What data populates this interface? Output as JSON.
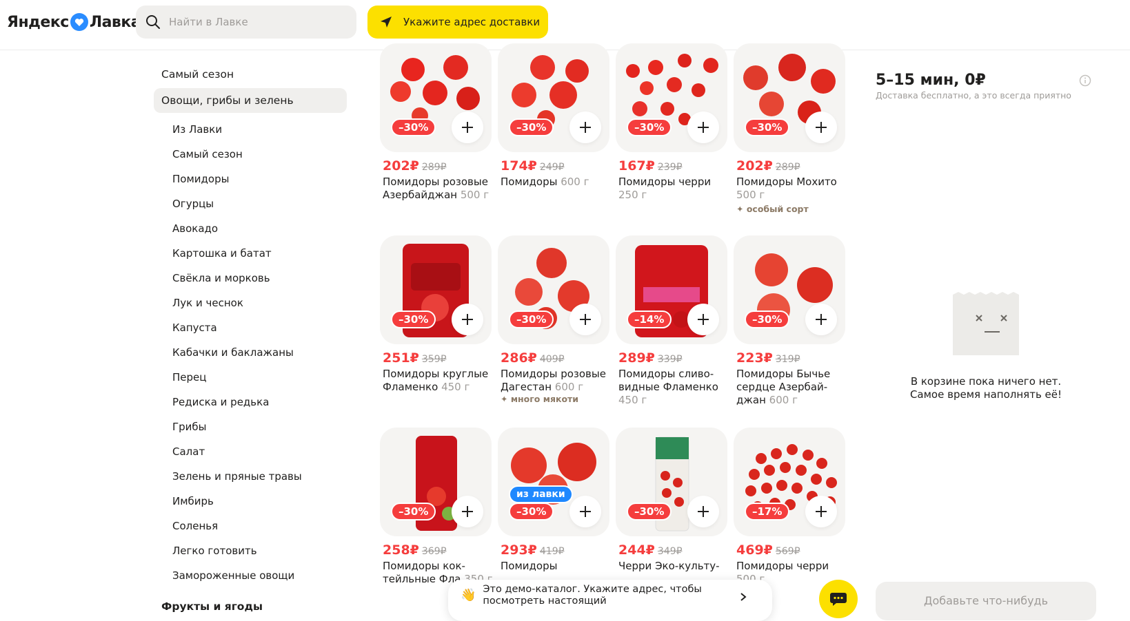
{
  "header": {
    "logo_text_1": "Яндекс",
    "logo_text_2": "Лавка",
    "search_placeholder": "Найти в Лавке",
    "address_button": "Укажите адрес доставки"
  },
  "sidebar": {
    "section_title": "Самый сезон",
    "active_category": "Овощи, грибы и зелень",
    "items": [
      "Из Лавки",
      "Самый сезон",
      "Помидоры",
      "Огурцы",
      "Авокадо",
      "Картошка и батат",
      "Свёкла и морковь",
      "Лук и чеснок",
      "Капуста",
      "Кабачки и баклажаны",
      "Перец",
      "Редиска и редька",
      "Грибы",
      "Салат",
      "Зелень и пряные травы",
      "Имбирь",
      "Соленья",
      "Легко готовить",
      "Замороженные овощи"
    ],
    "next_section": "Фрукты и ягоды"
  },
  "products": [
    {
      "discount": "–30%",
      "price": "202₽",
      "old_price": "289₽",
      "name": "Помидоры розовые Азербайджан",
      "weight": "500 г"
    },
    {
      "discount": "–30%",
      "price": "174₽",
      "old_price": "249₽",
      "name": "Помидоры",
      "weight": "600 г"
    },
    {
      "discount": "–30%",
      "price": "167₽",
      "old_price": "239₽",
      "name": "Помидоры черри",
      "weight": "250 г"
    },
    {
      "discount": "–30%",
      "price": "202₽",
      "old_price": "289₽",
      "name": "Помидоры Мохито",
      "weight": "500 г",
      "tag": "особый сорт"
    },
    {
      "discount": "–30%",
      "price": "251₽",
      "old_price": "359₽",
      "name": "Помидоры круглые Фламенко",
      "weight": "450 г"
    },
    {
      "discount": "–30%",
      "price": "286₽",
      "old_price": "409₽",
      "name": "Помидоры розовые Дагестан",
      "weight": "600 г",
      "tag": "много мякоти"
    },
    {
      "discount": "–14%",
      "price": "289₽",
      "old_price": "339₽",
      "name": "Помидоры сливо-видные Фламенко",
      "weight": "450 г"
    },
    {
      "discount": "–30%",
      "price": "223₽",
      "old_price": "319₽",
      "name": "Помидоры Бычье сердце Азербай-джан",
      "weight": "600 г"
    },
    {
      "discount": "–30%",
      "price": "258₽",
      "old_price": "369₽",
      "name": "Помидоры кок-тейльные Фла",
      "weight": "350 г"
    },
    {
      "discount": "–30%",
      "badge": "из лавки",
      "price": "293₽",
      "old_price": "419₽",
      "name": "Помидоры",
      "weight": ""
    },
    {
      "discount": "–30%",
      "price": "244₽",
      "old_price": "349₽",
      "name": "Черри Эко-культу-",
      "weight": ""
    },
    {
      "discount": "–17%",
      "price": "469₽",
      "old_price": "569₽",
      "name": "Помидоры черри",
      "weight": "500 г"
    }
  ],
  "cart": {
    "eta": "5–15 мин, 0₽",
    "eta_sub": "Доставка бесплатно, а это всегда приятно",
    "empty_line1": "В корзине пока ничего нет.",
    "empty_line2": "Самое время наполнять её!",
    "add_button": "Добавьте что-нибудь"
  },
  "demo_banner": {
    "text": "Это демо-каталог. Укажите адрес, чтобы посмотреть настоящий"
  },
  "colors": {
    "accent_yellow": "#fce000",
    "discount_red": "#f53d3d",
    "lavka_blue": "#1e88ff"
  }
}
